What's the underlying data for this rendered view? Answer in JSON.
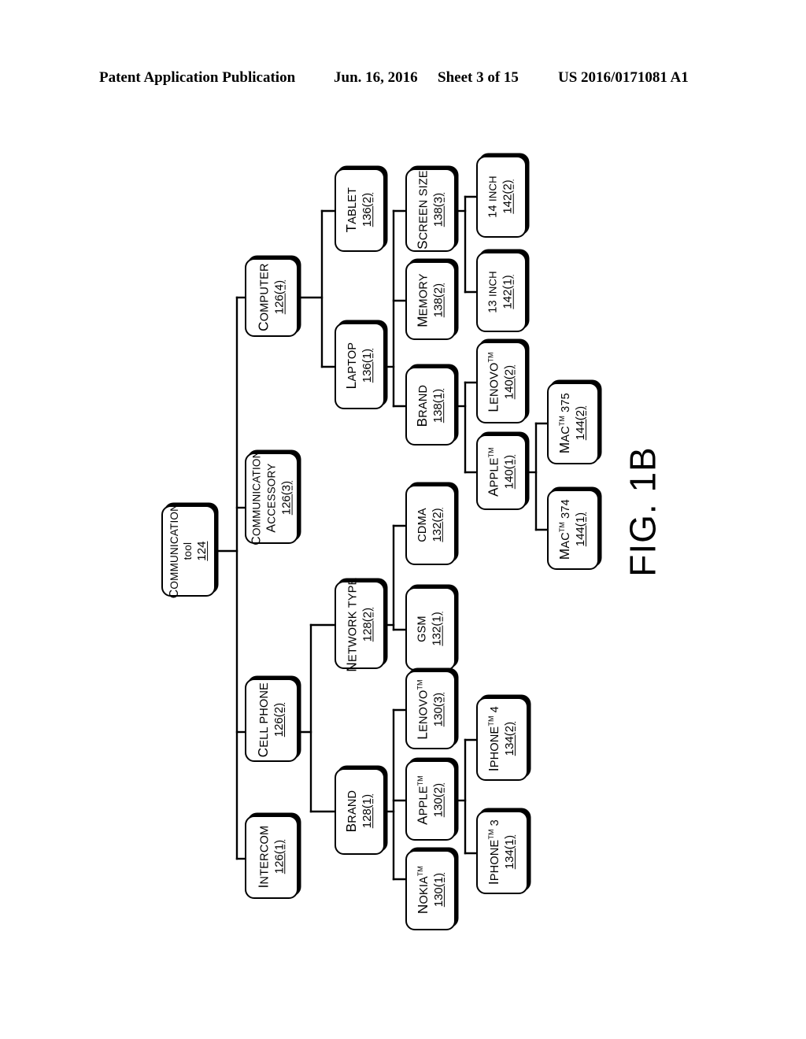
{
  "header": {
    "publication": "Patent Application Publication",
    "date": "Jun. 16, 2016",
    "sheet": "Sheet 3 of 15",
    "patent_number": "US 2016/0171081 A1"
  },
  "figure": {
    "label": "FIG. 1B",
    "type": "hierarchy-tree",
    "orientation": "rotated-90-left",
    "colors": {
      "line": "#000000",
      "box_fill": "#ffffff",
      "text": "#000000"
    }
  },
  "nodes": {
    "communication_tool": {
      "line1": "Communication",
      "line1b": "tool",
      "line2": "124"
    },
    "computer": {
      "line1": "Computer",
      "line2": "126(4)"
    },
    "communication_accessory": {
      "line1": "Communication",
      "line1b": "accessory",
      "line2": "126(3)"
    },
    "cell_phone": {
      "line1": "Cell phone",
      "line2": "126(2)"
    },
    "intercom": {
      "line1": "Intercom",
      "line2": "126(1)"
    },
    "tablet": {
      "line1": "Tablet",
      "line2": "136(2)"
    },
    "laptop": {
      "line1": "Laptop",
      "line2": "136(1)"
    },
    "screen_size": {
      "line1": "Screen size",
      "line2": "138(3)"
    },
    "memory": {
      "line1": "Memory",
      "line2": "138(2)"
    },
    "brand_computer": {
      "line1": "Brand",
      "line2": "138(1)"
    },
    "inch14": {
      "line1": "14 inch",
      "line2": "142(2)"
    },
    "inch13": {
      "line1": "13 inch",
      "line2": "142(1)"
    },
    "lenovo_computer": {
      "line1": "Lenovo",
      "sup": "TM",
      "line2": "140(2)"
    },
    "apple_computer": {
      "line1": "Apple",
      "sup": "TM",
      "line2": "140(1)"
    },
    "mac375": {
      "line1": "Mac",
      "sup": "TM",
      "suffix": " 375",
      "line2": "144(2)"
    },
    "mac374": {
      "line1": "Mac",
      "sup": "TM",
      "suffix": " 374",
      "line2": "144(1)"
    },
    "network_type": {
      "line1": "Network type",
      "line2": "128(2)"
    },
    "cdma": {
      "line1": "CDMA",
      "line2": "132(2)"
    },
    "gsm": {
      "line1": "GSM",
      "line2": "132(1)"
    },
    "brand_phone": {
      "line1": "Brand",
      "line2": "128(1)"
    },
    "lenovo_phone": {
      "line1": "Lenovo",
      "sup": "TM",
      "line2": "130(3)"
    },
    "apple_phone": {
      "line1": "Apple",
      "sup": "TM",
      "line2": "130(2)"
    },
    "nokia_phone": {
      "line1": "Nokia",
      "sup": "TM",
      "line2": "130(1)"
    },
    "iphone4": {
      "line1": "iPhone",
      "sup": "TM",
      "suffix": " 4",
      "line2": "134(2)"
    },
    "iphone3": {
      "line1": "iPhone",
      "sup": "TM",
      "suffix": " 3",
      "line2": "134(1)"
    }
  },
  "edges": [
    {
      "from": "communication_tool",
      "to": [
        "computer",
        "communication_accessory",
        "cell_phone",
        "intercom"
      ]
    },
    {
      "from": "computer",
      "to": [
        "tablet",
        "laptop"
      ]
    },
    {
      "from": "laptop",
      "to": [
        "screen_size",
        "memory",
        "brand_computer"
      ]
    },
    {
      "from": "screen_size",
      "to": [
        "inch14",
        "inch13"
      ]
    },
    {
      "from": "brand_computer",
      "to": [
        "lenovo_computer",
        "apple_computer"
      ]
    },
    {
      "from": "apple_computer",
      "to": [
        "mac375",
        "mac374"
      ]
    },
    {
      "from": "cell_phone",
      "to": [
        "network_type",
        "brand_phone"
      ]
    },
    {
      "from": "network_type",
      "to": [
        "cdma",
        "gsm"
      ]
    },
    {
      "from": "brand_phone",
      "to": [
        "lenovo_phone",
        "apple_phone",
        "nokia_phone"
      ]
    },
    {
      "from": "apple_phone",
      "to": [
        "iphone4",
        "iphone3"
      ]
    }
  ]
}
